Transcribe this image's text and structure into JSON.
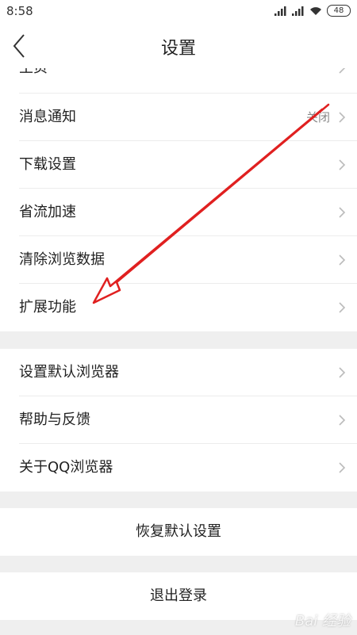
{
  "status_bar": {
    "time": "8:58",
    "battery": "48",
    "icons": [
      "signal-icon",
      "signal-icon",
      "wifi-icon",
      "battery-icon"
    ]
  },
  "header": {
    "title": "设置",
    "back_icon": "chevron-left-icon"
  },
  "group1": {
    "items": [
      {
        "label": "主页"
      },
      {
        "label": "消息通知",
        "value": "关闭"
      },
      {
        "label": "下载设置"
      },
      {
        "label": "省流加速"
      },
      {
        "label": "清除浏览数据"
      },
      {
        "label": "扩展功能"
      }
    ]
  },
  "group2": {
    "items": [
      {
        "label": "设置默认浏览器"
      },
      {
        "label": "帮助与反馈"
      },
      {
        "label": "关于QQ浏览器"
      }
    ]
  },
  "actions": {
    "restore_label": "恢复默认设置",
    "logout_label": "退出登录"
  },
  "annotation": {
    "color": "#e02020"
  },
  "watermark": {
    "text": "Bai 经验"
  }
}
